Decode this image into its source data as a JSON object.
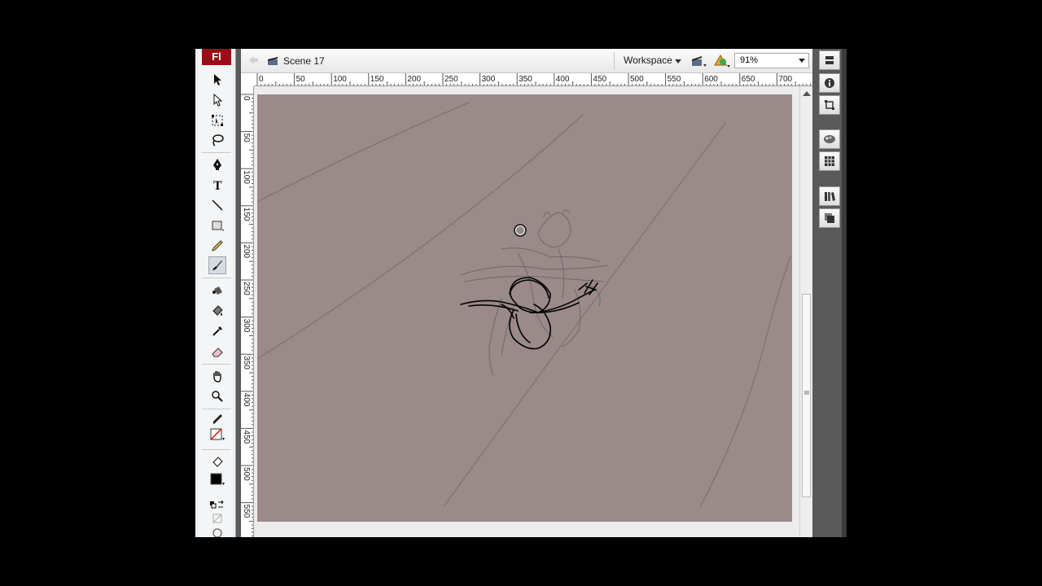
{
  "app": {
    "logo": "Fl"
  },
  "editbar": {
    "scene_label": "Scene 17",
    "workspace_label": "Workspace",
    "zoom_value": "91%"
  },
  "rulers": {
    "horizontal": [
      "0",
      "50",
      "100",
      "150",
      "200",
      "250",
      "300",
      "350",
      "400",
      "450",
      "500",
      "550",
      "600",
      "650",
      "700"
    ],
    "vertical": [
      "0",
      "50",
      "100",
      "150",
      "200",
      "250",
      "300",
      "350",
      "400",
      "450",
      "500",
      "550"
    ]
  },
  "tools": [
    {
      "name": "selection-tool",
      "icon": "arrow-icon"
    },
    {
      "name": "subselection-tool",
      "icon": "subselect-arrow-icon"
    },
    {
      "name": "free-transform-tool",
      "icon": "transform-icon"
    },
    {
      "name": "lasso-tool",
      "icon": "lasso-icon"
    },
    {
      "name": "pen-tool",
      "icon": "pen-icon"
    },
    {
      "name": "text-tool",
      "icon": "text-icon"
    },
    {
      "name": "line-tool",
      "icon": "line-icon"
    },
    {
      "name": "rectangle-tool",
      "icon": "rectangle-icon"
    },
    {
      "name": "pencil-tool",
      "icon": "pencil-icon"
    },
    {
      "name": "brush-tool",
      "icon": "brush-icon",
      "selected": true
    },
    {
      "name": "ink-bottle-tool",
      "icon": "ink-bottle-icon"
    },
    {
      "name": "paint-bucket-tool",
      "icon": "paint-bucket-icon"
    },
    {
      "name": "eyedropper-tool",
      "icon": "eyedropper-icon"
    },
    {
      "name": "eraser-tool",
      "icon": "eraser-icon"
    },
    {
      "name": "hand-tool",
      "icon": "hand-icon"
    },
    {
      "name": "zoom-tool",
      "icon": "magnifier-icon"
    }
  ],
  "colors": {
    "stage": "#9b8a8a",
    "stroke_color": "#000000",
    "fill_color": "#ff0000",
    "logo_bg": "#9b0d16"
  },
  "panels": [
    "align-panel",
    "info-panel",
    "transform-panel",
    "color-panel",
    "swatches-panel",
    "library-panel",
    "components-panel"
  ]
}
